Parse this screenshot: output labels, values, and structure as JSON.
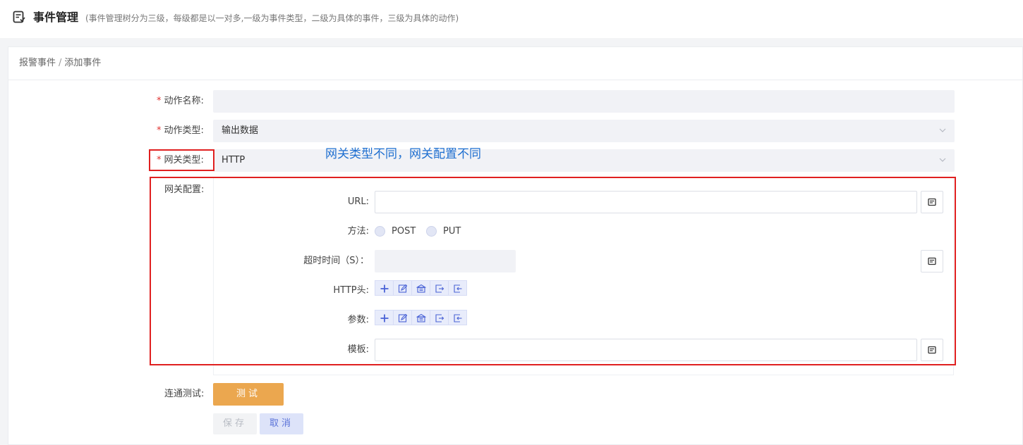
{
  "header": {
    "title": "事件管理",
    "subtitle": "(事件管理树分为三级，每级都是以一对多,一级为事件类型，二级为具体的事件，三级为具体的动作)"
  },
  "breadcrumb": {
    "parent": "报警事件",
    "separator": "/",
    "current": "添加事件"
  },
  "form": {
    "required_mark": "*",
    "action_name": {
      "label": "动作名称:",
      "value": ""
    },
    "action_type": {
      "label": "动作类型:",
      "value": "输出数据"
    },
    "gateway_type": {
      "label": "网关类型:",
      "value": "HTTP"
    },
    "gateway_config": {
      "label": "网关配置:",
      "url": {
        "label": "URL:",
        "value": ""
      },
      "method": {
        "label": "方法:",
        "options": [
          "POST",
          "PUT"
        ]
      },
      "timeout": {
        "label": "超时时间（S）：",
        "value": ""
      },
      "http_header": {
        "label": "HTTP头:"
      },
      "params": {
        "label": "参数:"
      },
      "template": {
        "label": "模板:",
        "value": ""
      }
    },
    "connectivity": {
      "label": "连通测试:",
      "button": "测试"
    },
    "save_button": "保存",
    "cancel_button": "取消"
  },
  "annotation": {
    "note": "网关类型不同，网关配置不同",
    "color": "#e02020",
    "text_color": "#1e6fd0"
  },
  "colors": {
    "accent_blue": "#5a72d8",
    "test_button": "#eba74f",
    "required": "#e0312f"
  },
  "toolbar_icons": [
    "add-icon",
    "edit-icon",
    "bank-icon",
    "export-icon",
    "import-icon"
  ]
}
